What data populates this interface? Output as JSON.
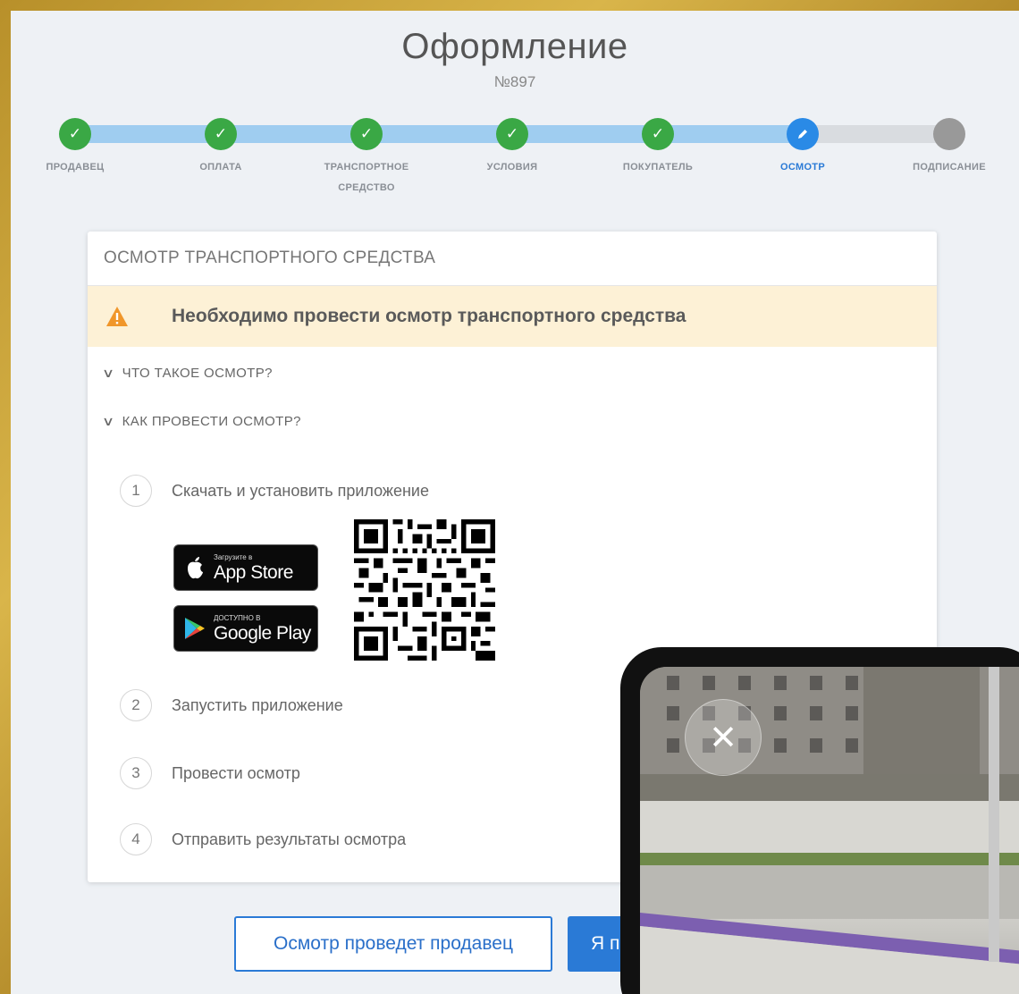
{
  "header": {
    "title": "Оформление",
    "order_number": "№897"
  },
  "steps": [
    {
      "label": "ПРОДАВЕЦ",
      "status": "done"
    },
    {
      "label": "ОПЛАТА",
      "status": "done"
    },
    {
      "label": "ТРАНСПОРТНОЕ СРЕДСТВО",
      "status": "done"
    },
    {
      "label": "УСЛОВИЯ",
      "status": "done"
    },
    {
      "label": "ПОКУПАТЕЛЬ",
      "status": "done"
    },
    {
      "label": "ОСМОТР",
      "status": "current"
    },
    {
      "label": "ПОДПИСАНИЕ",
      "status": "future"
    }
  ],
  "card": {
    "title": "ОСМОТР ТРАНСПОРТНОГО СРЕДСТВА",
    "alert": "Необходимо провести осмотр транспортного средства",
    "faq_what": "ЧТО ТАКОЕ ОСМОТР?",
    "faq_how": "КАК ПРОВЕСТИ ОСМОТР?",
    "instructions": [
      {
        "num": "1",
        "text": "Скачать и установить приложение"
      },
      {
        "num": "2",
        "text": "Запустить приложение"
      },
      {
        "num": "3",
        "text": "Провести осмотр"
      },
      {
        "num": "4",
        "text": "Отправить результаты осмотра"
      }
    ],
    "app_store": {
      "small": "Загрузите в",
      "big": "App Store"
    },
    "google_play": {
      "small": "ДОСТУПНО В",
      "big": "Google Play"
    }
  },
  "buttons": {
    "seller_inspects": "Осмотр проведет продавец",
    "primary_partial": "Я п"
  },
  "phone": {
    "close_glyph": "✕"
  },
  "colors": {
    "done": "#3aa845",
    "current": "#2a8ae6",
    "future": "#999999",
    "accent": "#2a7ad6",
    "alert_bg": "#fdf1d6"
  }
}
